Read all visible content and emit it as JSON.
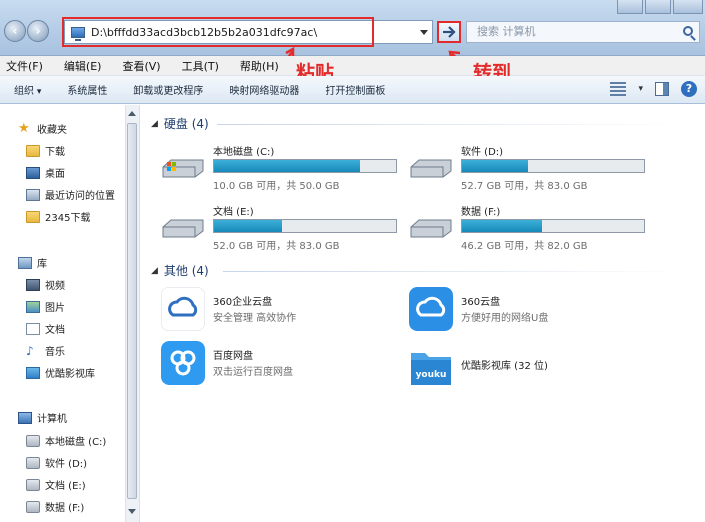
{
  "address_bar": {
    "path": "D:\\bfffdd33acd3bcb12b5b2a031dfc97ac\\",
    "search_placeholder": "搜索 计算机"
  },
  "annotations": {
    "paste": "粘贴",
    "goto": "转到"
  },
  "menu": [
    "文件(F)",
    "编辑(E)",
    "查看(V)",
    "工具(T)",
    "帮助(H)"
  ],
  "toolbar": {
    "organize": "组织",
    "items": [
      "系统属性",
      "卸载或更改程序",
      "映射网络驱动器",
      "打开控制面板"
    ]
  },
  "nav": {
    "favorites": "收藏夹",
    "downloads": "下载",
    "desktop": "桌面",
    "recent": "最近访问的位置",
    "folder2345": "2345下载",
    "libraries": "库",
    "videos": "视频",
    "pictures": "图片",
    "documents": "文档",
    "music": "音乐",
    "youku": "优酷影视库",
    "computer": "计算机",
    "drive_c": "本地磁盘 (C:)",
    "drive_d": "软件 (D:)",
    "drive_e": "文档 (E:)",
    "drive_f": "数据 (F:)"
  },
  "content": {
    "hard_disks_header": "硬盘 (4)",
    "other_header": "其他 (4)",
    "drives": [
      {
        "name": "本地磁盘 (C:)",
        "free": "10.0 GB 可用，共 50.0 GB",
        "used_fraction": 0.8
      },
      {
        "name": "软件 (D:)",
        "free": "52.7 GB 可用，共 83.0 GB",
        "used_fraction": 0.365
      },
      {
        "name": "文档 (E:)",
        "free": "52.0 GB 可用，共 83.0 GB",
        "used_fraction": 0.373
      },
      {
        "name": "数据 (F:)",
        "free": "46.2 GB 可用，共 82.0 GB",
        "used_fraction": 0.437
      }
    ],
    "apps": [
      {
        "name": "360企业云盘",
        "desc": "安全管理 高效协作"
      },
      {
        "name": "360云盘",
        "desc": "方便好用的网络U盘"
      },
      {
        "name": "百度网盘",
        "desc": "双击运行百度网盘"
      },
      {
        "name": "优酷影视库 (32 位)",
        "desc": ""
      }
    ],
    "youku_logo": "youku"
  },
  "colors": {
    "annotation_red": "#e32b2b",
    "drive_fill": "#1789b9"
  }
}
